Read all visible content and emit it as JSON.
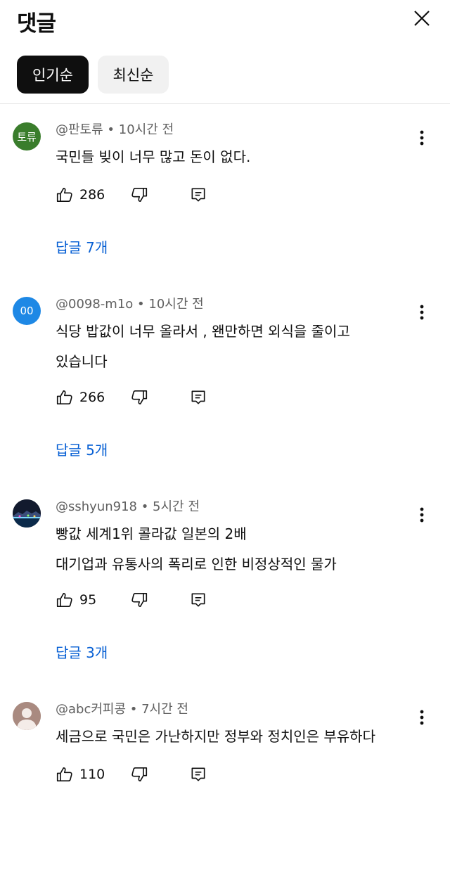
{
  "header": {
    "title": "댓글",
    "close_icon": "close-icon"
  },
  "sort": {
    "top": "인기순",
    "newest": "최신순"
  },
  "comments": [
    {
      "avatar_text": "토류",
      "avatar_color": "#3a7d2c",
      "meta": "@판토류 • 10시간 전",
      "lines": [
        "국민들 빚이 너무 많고 돈이 없다."
      ],
      "likes": "286",
      "replies": "답글 7개"
    },
    {
      "avatar_text": "00",
      "avatar_color": "#1e88e5",
      "meta": "@0098-m1o • 10시간 전",
      "lines": [
        "식당 밥값이 너무 올라서 , 왠만하면 외식을 줄이고",
        "있습니다"
      ],
      "likes": "266",
      "replies": "답글 5개"
    },
    {
      "avatar_text": "",
      "avatar_color": "#101828",
      "meta": "@sshyun918 • 5시간 전",
      "lines": [
        "빵값 세계1위 콜라값 일본의 2배",
        "대기업과 유통사의 폭리로 인한 비정상적인 물가"
      ],
      "likes": "95",
      "replies": "답글 3개"
    },
    {
      "avatar_text": "",
      "avatar_color": "#a98a80",
      "meta": "@abc커피콩 • 7시간 전",
      "lines": [
        "세금으로 국민은 가난하지만 정부와 정치인은 부유하다"
      ],
      "likes": "110"
    }
  ],
  "colors": {
    "accent": "#065fd4",
    "text": "#0f0f0f",
    "muted": "#606060"
  },
  "icons": [
    "like-icon",
    "dislike-icon",
    "reply-icon",
    "more-vert-icon"
  ]
}
